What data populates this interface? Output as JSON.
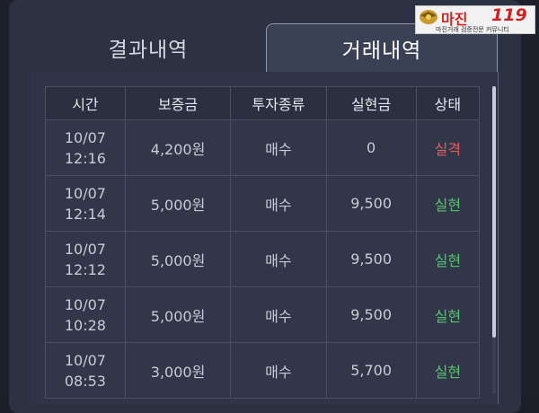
{
  "tabs": [
    {
      "label": "결과내역",
      "active": false
    },
    {
      "label": "거래내역",
      "active": true
    }
  ],
  "logo": {
    "main": "마진",
    "num": "119",
    "sub": "마진거래 검증전문 커뮤니티"
  },
  "table": {
    "headers": [
      "시간",
      "보증금",
      "투자종류",
      "실현금",
      "상태"
    ],
    "rows": [
      {
        "date": "10/07",
        "time": "12:16",
        "deposit": "4,200원",
        "type": "매수",
        "realized": "0",
        "status": "실격"
      },
      {
        "date": "10/07",
        "time": "12:14",
        "deposit": "5,000원",
        "type": "매수",
        "realized": "9,500",
        "status": "실현"
      },
      {
        "date": "10/07",
        "time": "12:12",
        "deposit": "5,000원",
        "type": "매수",
        "realized": "9,500",
        "status": "실현"
      },
      {
        "date": "10/07",
        "time": "10:28",
        "deposit": "5,000원",
        "type": "매수",
        "realized": "9,500",
        "status": "실현"
      },
      {
        "date": "10/07",
        "time": "08:53",
        "deposit": "3,000원",
        "type": "매수",
        "realized": "5,700",
        "status": "실현"
      }
    ]
  },
  "colors": {
    "status_fail": "#e35d5d",
    "status_ok": "#54c56c",
    "logo_red": "#d21f1f"
  }
}
